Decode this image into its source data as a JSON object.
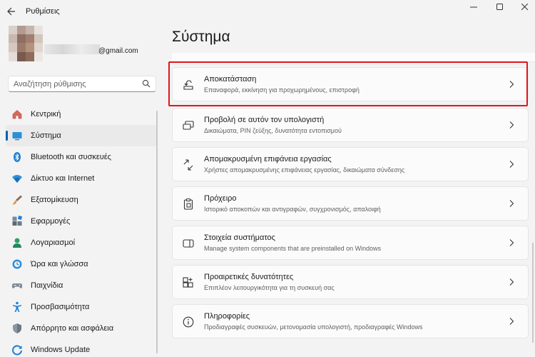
{
  "window": {
    "title": "Ρυθμίσεις"
  },
  "account": {
    "email": "@gmail.com"
  },
  "search": {
    "placeholder": "Αναζήτηση ρύθμισης"
  },
  "sidebar": {
    "items": [
      {
        "label": "Κεντρική",
        "icon": "home-icon",
        "active": false
      },
      {
        "label": "Σύστημα",
        "icon": "system-monitor-icon",
        "active": true
      },
      {
        "label": "Bluetooth και συσκευές",
        "icon": "bluetooth-icon",
        "active": false
      },
      {
        "label": "Δίκτυο και Internet",
        "icon": "wifi-icon",
        "active": false
      },
      {
        "label": "Εξατομίκευση",
        "icon": "paintbrush-icon",
        "active": false
      },
      {
        "label": "Εφαρμογές",
        "icon": "apps-icon",
        "active": false
      },
      {
        "label": "Λογαριασμοί",
        "icon": "person-icon",
        "active": false
      },
      {
        "label": "Ώρα και γλώσσα",
        "icon": "clock-globe-icon",
        "active": false
      },
      {
        "label": "Παιχνίδια",
        "icon": "gamepad-icon",
        "active": false
      },
      {
        "label": "Προσβασιμότητα",
        "icon": "accessibility-icon",
        "active": false
      },
      {
        "label": "Απόρρητο και ασφάλεια",
        "icon": "shield-icon",
        "active": false
      },
      {
        "label": "Windows Update",
        "icon": "update-icon",
        "active": false
      }
    ]
  },
  "main": {
    "title": "Σύστημα",
    "cards": [
      {
        "title": "Αποκατάσταση",
        "subtitle": "Επαναφορά, εκκίνηση για προχωρημένους, επιστροφή",
        "icon": "recovery-icon"
      },
      {
        "title": "Προβολή σε αυτόν τον υπολογιστή",
        "subtitle": "Δικαιώματα, PIN ζεύξης, δυνατότητα εντοπισμού",
        "icon": "project-icon"
      },
      {
        "title": "Απομακρυσμένη επιφάνεια εργασίας",
        "subtitle": "Χρήστες απομακρυσμένης επιφάνειας εργασίας, δικαιώματα σύνδεσης",
        "icon": "remote-desktop-icon"
      },
      {
        "title": "Πρόχειρο",
        "subtitle": "Ιστορικό αποκοπών και αντιγραφών, συγχρονισμός, απαλοιφή",
        "icon": "clipboard-icon"
      },
      {
        "title": "Στοιχεία συστήματος",
        "subtitle": "Manage system components that are preinstalled on Windows",
        "icon": "system-components-icon"
      },
      {
        "title": "Προαιρετικές δυνατότητες",
        "subtitle": "Επιπλέον λειτουργικότητα για τη συσκευή σας",
        "icon": "optional-features-icon"
      },
      {
        "title": "Πληροφορίες",
        "subtitle": "Προδιαγραφές συσκευών, μετονομασία υπολογιστή, προδιαγραφές Windows",
        "icon": "info-icon"
      }
    ]
  },
  "colors": {
    "accent": "#005fb8",
    "highlight": "#e3141c",
    "background": "#f3f3f3",
    "card": "#fbfbfb"
  }
}
